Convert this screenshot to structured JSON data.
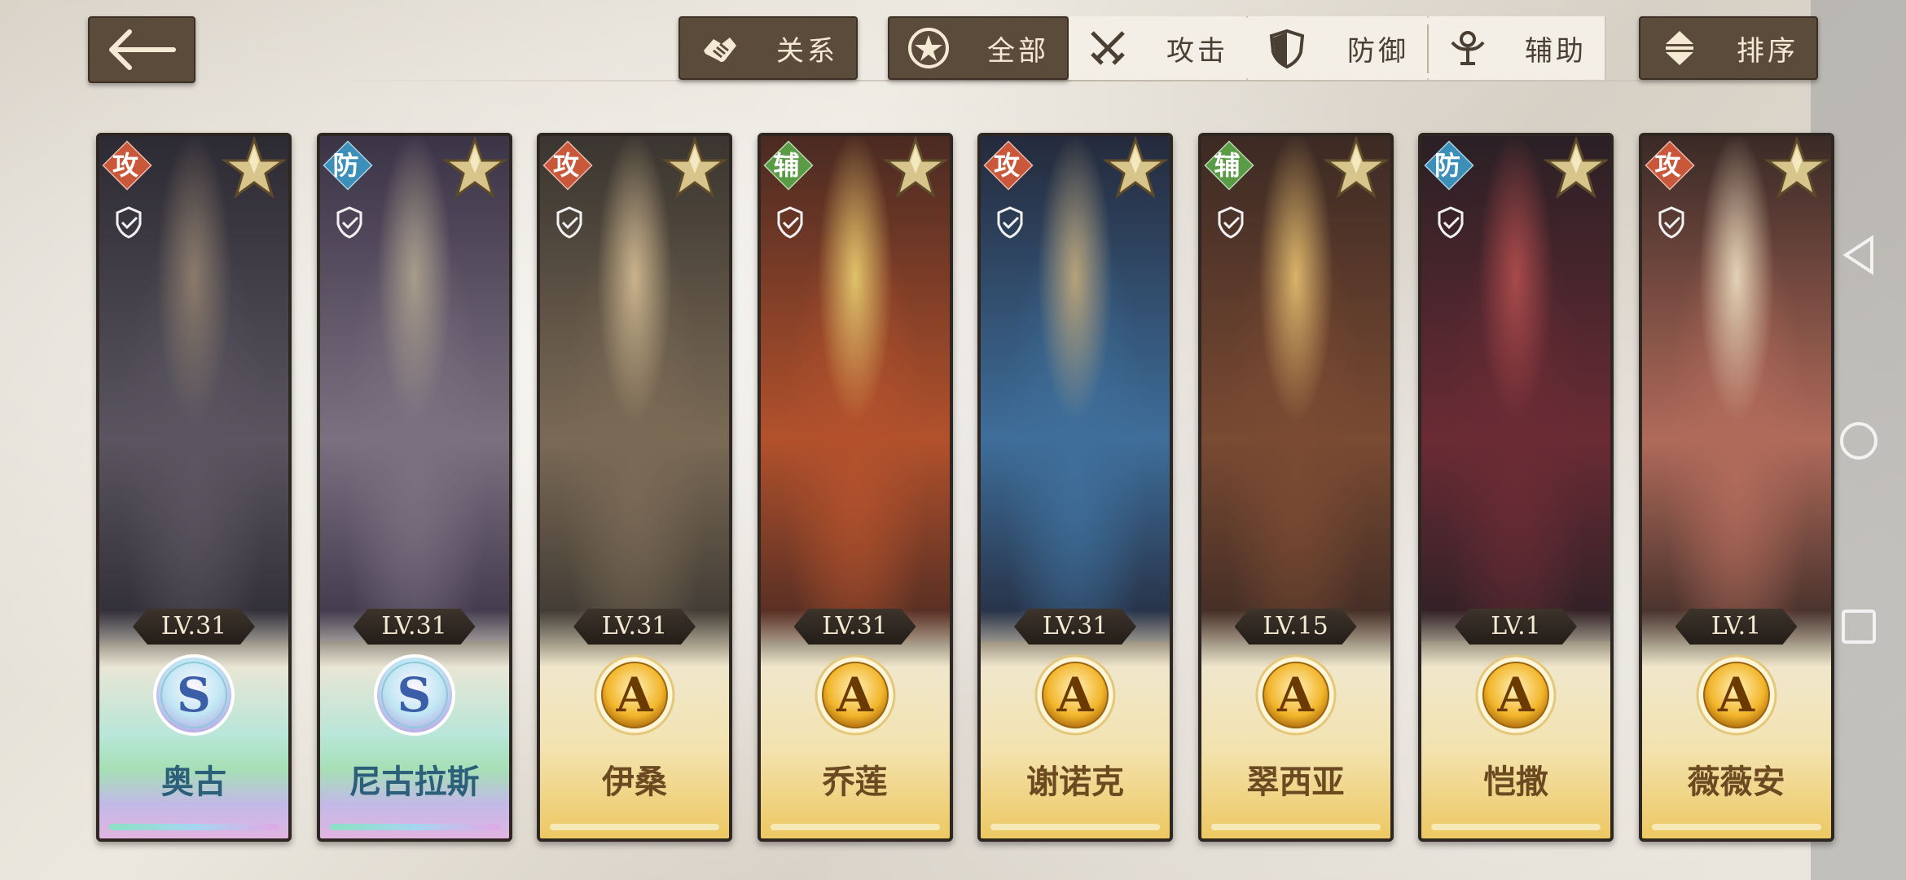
{
  "toolbar": {
    "relation_label": "关系",
    "sort_label": "排序",
    "filters": [
      {
        "label": "全部",
        "icon": "star-circle-icon",
        "selected": true
      },
      {
        "label": "攻击",
        "icon": "crossed-swords-icon",
        "selected": false
      },
      {
        "label": "防御",
        "icon": "shield-icon",
        "selected": false
      },
      {
        "label": "辅助",
        "icon": "support-figure-icon",
        "selected": false
      }
    ]
  },
  "characters": [
    {
      "name": "奥古",
      "role": "攻",
      "role_color": "#c9573a",
      "level": "LV.31",
      "grade": "S",
      "tier": "rainbow"
    },
    {
      "name": "尼古拉斯",
      "role": "防",
      "role_color": "#3c8fb8",
      "level": "LV.31",
      "grade": "S",
      "tier": "rainbow"
    },
    {
      "name": "伊桑",
      "role": "攻",
      "role_color": "#c9573a",
      "level": "LV.31",
      "grade": "A",
      "tier": "gold"
    },
    {
      "name": "乔莲",
      "role": "辅",
      "role_color": "#5a9c45",
      "level": "LV.31",
      "grade": "A",
      "tier": "gold"
    },
    {
      "name": "谢诺克",
      "role": "攻",
      "role_color": "#c9573a",
      "level": "LV.31",
      "grade": "A",
      "tier": "gold"
    },
    {
      "name": "翠西亚",
      "role": "辅",
      "role_color": "#5a9c45",
      "level": "LV.15",
      "grade": "A",
      "tier": "gold"
    },
    {
      "name": "恺撒",
      "role": "防",
      "role_color": "#3c8fb8",
      "level": "LV.1",
      "grade": "A",
      "tier": "gold"
    },
    {
      "name": "薇薇安",
      "role": "攻",
      "role_color": "#c9573a",
      "level": "LV.1",
      "grade": "A",
      "tier": "gold"
    }
  ]
}
